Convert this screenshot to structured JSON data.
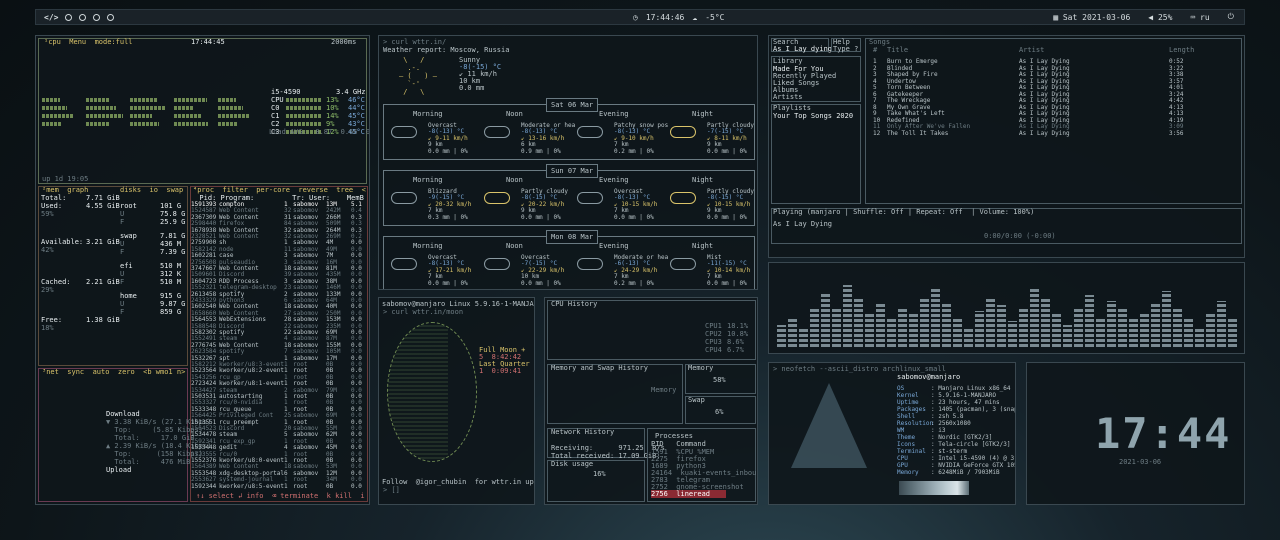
{
  "topbar": {
    "logo": "</>",
    "clock": "17:44:46",
    "weather": "-5°C",
    "date": "Sat 2021-03-06",
    "volume": "25%",
    "lang": "ru"
  },
  "bpytop": {
    "header": "¹cpu  Menu  mode:full",
    "time": "17:44:45",
    "rate": "2000ms",
    "cpu_model": "i5-4590",
    "freq": "3.4 GHz",
    "cpu_rows": [
      "CPU",
      "C0",
      "C1",
      "C2",
      "C3"
    ],
    "cpu_pct": [
      "13%",
      "10%",
      "14%",
      "9%",
      "12%"
    ],
    "cpu_temp": [
      "46°C",
      "44°C",
      "45°C",
      "43°C",
      "45°C"
    ],
    "load": "Load AVG:  0.87  0.66  0.57",
    "uptime": "up 1d 19:05",
    "mem_header": "²mem  graph",
    "mem": [
      [
        "Total:",
        "7.71 GiB"
      ],
      [
        "Used:",
        "4.55 GiB"
      ],
      [
        "59%",
        ""
      ],
      [
        "Available:",
        "3.21 GiB"
      ],
      [
        "42%",
        ""
      ],
      [
        "Cached:",
        "2.21 GiB"
      ],
      [
        "29%",
        ""
      ],
      [
        "Free:",
        "1.38 GiB"
      ],
      [
        "18%",
        ""
      ]
    ],
    "disks_header": "disks  io  swap",
    "disks": [
      [
        "root",
        "101 G"
      ],
      [
        "U",
        "75.8 G"
      ],
      [
        "F",
        "25.9 G"
      ],
      [
        "swap",
        "7.81 G"
      ],
      [
        "U",
        "436 M"
      ],
      [
        "F",
        "7.39 G"
      ],
      [
        "efi",
        "510 M"
      ],
      [
        "U",
        "312 K"
      ],
      [
        "F",
        "510 M"
      ],
      [
        "home",
        "915 G"
      ],
      [
        "U",
        "9.87 G"
      ],
      [
        "F",
        "859 G"
      ]
    ],
    "net_header": "³net  sync  auto  zero  <b wmo1 n>",
    "net": [
      "Download",
      "▼ 3.38 KiB/s (27.1 Kibps)",
      "  Top:     (5.85 Kibps)",
      "  Total:     17.0 GiB",
      "▲ 2.39 KiB/s (18.4 Kibps)",
      "  Top:      (158 Kibps)",
      "  Total:     476 MiB",
      "Upload"
    ],
    "proc_header": "⁴proc  filter  per-core  reverse  tree  < cpu lazy >",
    "proc_cols": "  Pid: Program:         Tr: User:    MemB    Cpu%",
    "procs": [
      [
        "1591393",
        "compton",
        "1",
        "sabomov",
        "13M",
        "5.1"
      ],
      [
        "1524587",
        "Web Content",
        "32",
        "sabomov",
        "242M",
        "0.4"
      ],
      [
        "2367309",
        "Web Content",
        "31",
        "sabomov",
        "266M",
        "0.3"
      ],
      [
        "2598440",
        "firefox",
        "84",
        "sabomov",
        "509M",
        "0.3"
      ],
      [
        "1678938",
        "Web Content",
        "32",
        "sabomov",
        "264M",
        "0.3"
      ],
      [
        "2328521",
        "Web Content",
        "32",
        "sabomov",
        "269M",
        "0.2"
      ],
      [
        "2759900",
        "sh",
        "1",
        "sabomov",
        "4M",
        "0.0"
      ],
      [
        "1582142",
        "node",
        "11",
        "sabomov",
        "49M",
        "0.0"
      ],
      [
        "1602281",
        "case",
        "3",
        "sabomov",
        "7M",
        "0.0"
      ],
      [
        "2756508",
        "pulseaudio",
        "3",
        "sabomov",
        "16M",
        "0.0"
      ],
      [
        "3747667",
        "Web Content",
        "18",
        "sabomov",
        "81M",
        "0.0"
      ],
      [
        "1509601",
        "Discord",
        "39",
        "sabomov",
        "435M",
        "0.0"
      ],
      [
        "1604723",
        "RDD Process",
        "3",
        "sabomov",
        "38M",
        "0.0"
      ],
      [
        "1552321",
        "telegram-desktop",
        "23",
        "sabomov",
        "146M",
        "0.0"
      ],
      [
        "2613458",
        "spotify",
        "2",
        "sabomov",
        "133M",
        "0.0"
      ],
      [
        "2433329",
        "python3",
        "6",
        "sabomov",
        "64M",
        "0.0"
      ],
      [
        "1602540",
        "Web Content",
        "18",
        "sabomov",
        "40M",
        "0.0"
      ],
      [
        "1658660",
        "Web Content",
        "27",
        "sabomov",
        "250M",
        "0.0"
      ],
      [
        "1564553",
        "WebExtensions",
        "28",
        "sabomov",
        "153M",
        "0.0"
      ],
      [
        "1588548",
        "Discord",
        "22",
        "sabomov",
        "235M",
        "0.0"
      ],
      [
        "1582302",
        "spotify",
        "22",
        "sabomov",
        "69M",
        "0.0"
      ],
      [
        "1552491",
        "steam",
        "4",
        "sabomov",
        "87M",
        "0.0"
      ],
      [
        "2776745",
        "Web Content",
        "18",
        "sabomov",
        "155M",
        "0.0"
      ],
      [
        "2623584",
        "spotify",
        "7",
        "sabomov",
        "105M",
        "0.0"
      ],
      [
        "1532267",
        "spt",
        "1",
        "sabomov",
        "17M",
        "0.0"
      ],
      [
        "1582212",
        "kworker/u8:3-event",
        "1",
        "root",
        "0B",
        "0.0"
      ],
      [
        "1523564",
        "kworker/u8:2-event",
        "1",
        "root",
        "0B",
        "0.0"
      ],
      [
        "1543256",
        "rcu_gp",
        "1",
        "root",
        "0B",
        "0.0"
      ],
      [
        "2723424",
        "kworker/u8:1-event",
        "1",
        "root",
        "0B",
        "0.0"
      ],
      [
        "1534427",
        "steam",
        "2",
        "sabomov",
        "79M",
        "0.0"
      ],
      [
        "1503531",
        "autostarting",
        "1",
        "root",
        "0B",
        "0.0"
      ],
      [
        "1553327",
        "rcu/0-nvidia",
        "1",
        "root",
        "0B",
        "0.0"
      ],
      [
        "1533348",
        "rcu_queue",
        "1",
        "root",
        "0B",
        "0.0"
      ],
      [
        "1564425",
        "Privileged Cont",
        "25",
        "sabomov",
        "69M",
        "0.0"
      ],
      [
        "1513551",
        "rcu_preempt",
        "1",
        "root",
        "0B",
        "0.0"
      ],
      [
        "1564523",
        "Discord",
        "20",
        "sabomov",
        "55M",
        "0.0"
      ],
      [
        "1534478",
        "steam",
        "5",
        "sabomov",
        "62M",
        "0.0"
      ],
      [
        "1592341",
        "rcu_exp_gp",
        "1",
        "root",
        "0B",
        "0.0"
      ],
      [
        "1533448",
        "gedit",
        "4",
        "sabomov",
        "45M",
        "0.0"
      ],
      [
        "1723555",
        "rcu/0",
        "1",
        "root",
        "0B",
        "0.0"
      ],
      [
        "1552376",
        "kworker/u8:0-event",
        "1",
        "root",
        "0B",
        "0.0"
      ],
      [
        "1564389",
        "Web Content",
        "18",
        "sabomov",
        "53M",
        "0.0"
      ],
      [
        "1553548",
        "xdg-desktop-portal",
        "6",
        "sabomov",
        "12M",
        "0.0"
      ],
      [
        "2553627",
        "systemd-journal",
        "1",
        "root",
        "34M",
        "0.0"
      ],
      [
        "1592344",
        "kworker/u8:5-event",
        "1",
        "root",
        "0B",
        "0.0"
      ]
    ],
    "proc_footer": "↑↓ select ↲ info  ⌫ terminate  k kill  i interrupt  1/229"
  },
  "wttr": {
    "prompt": "> curl wttr.in/",
    "report": "Weather report: Moscow, Russia",
    "now": [
      "Sunny",
      "-8(-15) °C",
      "↙ 11 km/h",
      "10 km",
      "0.0 mm"
    ],
    "parts": [
      "Morning",
      "Noon",
      "Evening",
      "Night"
    ],
    "days": [
      {
        "date": "Sat 06 Mar",
        "cells": [
          [
            "Overcast",
            "-8(-13) °C",
            "↙ 9-11 km/h",
            "9 km",
            "0.0 mm | 0%"
          ],
          [
            "Moderate or hea",
            "-8(-13) °C",
            "↙ 13-16 km/h",
            "6 km",
            "0.9 mm | 0%"
          ],
          [
            "Patchy snow pos",
            "-8(-13) °C",
            "↙ 9-10 km/h",
            "7 km",
            "0.2 mm | 0%"
          ],
          [
            "Partly cloudy",
            "-7(-15) °C",
            "↙ 8-11 km/h",
            "9 km",
            "0.0 mm | 0%"
          ]
        ]
      },
      {
        "date": "Sun 07 Mar",
        "cells": [
          [
            "Blizzard",
            "-9(-15) °C",
            "↙ 20-32 km/h",
            "7 km",
            "0.3 mm | 0%"
          ],
          [
            "Partly cloudy",
            "-8(-15) °C",
            "↙ 20-22 km/h",
            "9 km",
            "0.0 mm | 0%"
          ],
          [
            "Overcast",
            "-8(-13) °C",
            "↙ 10-15 km/h",
            "7 km",
            "0.0 mm | 0%"
          ],
          [
            "Partly cloudy",
            "-8(-15) °C",
            "↙ 10-15 km/h",
            "9 km",
            "0.0 mm | 0%"
          ]
        ]
      },
      {
        "date": "Mon 08 Mar",
        "cells": [
          [
            "Overcast",
            "-8(-13) °C",
            "↙ 17-21 km/h",
            "7 km",
            "0.0 mm | 0%"
          ],
          [
            "Overcast",
            "-7(-15) °C",
            "↙ 22-29 km/h",
            "10 km",
            "0.0 mm | 0%"
          ],
          [
            "Moderate or hea",
            "-6(-13) °C",
            "↙ 24-29 km/h",
            "7 km",
            "0.2 mm | 0%"
          ],
          [
            "Mist",
            "-11(-15) °C",
            "↙ 10-14 km/h",
            "7 km",
            "0.0 mm | 0%"
          ]
        ]
      }
    ]
  },
  "moon": {
    "title": "sabomov@manjaro Linux 5.9.16-1-MANJARO x86_64 20",
    "prompt": "> curl wttr.in/moon",
    "info": [
      "Full Moon +",
      "5  8:42:42",
      "Last Quarter -",
      "1  0:09:41"
    ],
    "follow": "Follow  @igor_chubin  for wttr.in updates",
    "prompt2": "> []"
  },
  "gtop": {
    "cpu_title": "CPU History",
    "cpu_legend": [
      [
        "CPU1",
        "18.1%"
      ],
      [
        "CPU2",
        "10.8%"
      ],
      [
        "CPU3",
        "8.6%"
      ],
      [
        "CPU4",
        "6.7%"
      ]
    ],
    "mem_title": "Memory and Swap History",
    "mem_legend": "Memory",
    "memory_title": "Memory",
    "memory_val": "58%",
    "swap_title": "Swap",
    "swap_val": "6%",
    "net_title": "Network History",
    "net_lines": [
      "Receiving:      971.25  B/s",
      "Total received: 17.09 GiB;"
    ],
    "disk_title": "Disk usage",
    "disk_val": "16%",
    "proc_title": "Processes",
    "proc_cols": "PID   Command",
    "procs": [
      [
        "1591",
        "%CPU %MEM"
      ],
      [
        "2275",
        "firefox"
      ],
      [
        "1689",
        "python3"
      ],
      [
        "24164",
        "kuaki-events_inbound"
      ],
      [
        "2783",
        "telegram"
      ],
      [
        "2752",
        "gnome-screenshot"
      ],
      [
        "2756",
        "lineread"
      ]
    ]
  },
  "spotify": {
    "search_label": "Search",
    "search_val": "As I Lay dying",
    "help_label": "Help",
    "help_val": "Type ?",
    "library_title": "Library",
    "library": [
      "Made For You",
      "Recently Played",
      "Liked Songs",
      "Albums",
      "Artists"
    ],
    "playlists_title": "Playlists",
    "playlists": [
      "Your Top Songs 2020"
    ],
    "songs_title": "Songs",
    "cols": [
      "#",
      "Title",
      "Artist",
      "Length"
    ],
    "songs": [
      [
        "1",
        "Burn to Emerge",
        "As I Lay Dying",
        "0:52"
      ],
      [
        "2",
        "Blinded",
        "As I Lay Dying",
        "3:22"
      ],
      [
        "3",
        "Shaped by Fire",
        "As I Lay Dying",
        "3:38"
      ],
      [
        "4",
        "Undertow",
        "As I Lay Dying",
        "3:57"
      ],
      [
        "5",
        "Torn Between",
        "As I Lay Dying",
        "4:01"
      ],
      [
        "6",
        "Gatekeeper",
        "As I Lay Dying",
        "3:24"
      ],
      [
        "7",
        "The Wreckage",
        "As I Lay Dying",
        "4:42"
      ],
      [
        "8",
        "My Own Grave",
        "As I Lay Dying",
        "4:13"
      ],
      [
        "9",
        "Take What's Left",
        "As I Lay Dying",
        "4:13"
      ],
      [
        "10",
        "Redefined",
        "As I Lay Dying",
        "4:19"
      ],
      [
        "11",
        "Only After We've Fallen",
        "As I Lay Dying",
        "3:09"
      ],
      [
        "12",
        "The Toll It Takes",
        "As I Lay Dying",
        "3:56"
      ]
    ],
    "status": "Playing (manjaro | Shuffle: Off | Repeat: Off  | Volume: 100%)",
    "now_playing": "As I Lay Dying",
    "progress": "0:00/0:00 (-0:00)"
  },
  "neofetch": {
    "prompt": "> neofetch --ascii_distro archlinux_small",
    "user": "sabomov@manjaro",
    "lines": [
      [
        "OS",
        "Manjaro Linux x86_64"
      ],
      [
        "Kernel",
        "5.9.16-1-MANJARO"
      ],
      [
        "Uptime",
        "23 hours, 47 mins"
      ],
      [
        "Packages",
        "1405 (pacman), 3 (snap)"
      ],
      [
        "Shell",
        "zsh 5.8"
      ],
      [
        "Resolution",
        "2560x1080"
      ],
      [
        "WM",
        "i3"
      ],
      [
        "Theme",
        "Nordic [GTK2/3]"
      ],
      [
        "Icons",
        "Tela-circle [GTK2/3]"
      ],
      [
        "Terminal",
        "st-sterm"
      ],
      [
        "CPU",
        "Intel i5-4590 (4) @ 3.700GHz"
      ],
      [
        "GPU",
        "NVIDIA GeForce GTX 1050 Ti"
      ],
      [
        "Memory",
        "6248MiB / 7903MiB"
      ]
    ]
  },
  "tty_clock": {
    "time": "17:44",
    "date": "2021-03-06"
  },
  "colors": {
    "accent": "#8a2a33",
    "green": "#8fbf6a",
    "yellow": "#d9c36a",
    "panel": "#0e161b"
  }
}
